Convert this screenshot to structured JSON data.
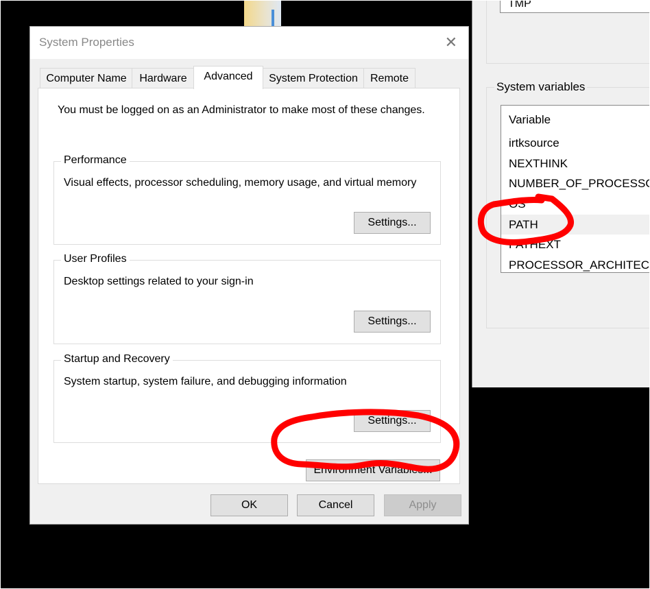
{
  "dialog": {
    "title": "System Properties",
    "close_icon": "close-icon",
    "tabs": [
      {
        "label": "Computer Name"
      },
      {
        "label": "Hardware"
      },
      {
        "label": "Advanced",
        "active": true
      },
      {
        "label": "System Protection"
      },
      {
        "label": "Remote"
      }
    ],
    "admin_note": "You must be logged on as an Administrator to make most of these changes.",
    "groups": [
      {
        "title": "Performance",
        "description": "Visual effects, processor scheduling, memory usage, and virtual memory",
        "button": "Settings..."
      },
      {
        "title": "User Profiles",
        "description": "Desktop settings related to your sign-in",
        "button": "Settings..."
      },
      {
        "title": "Startup and Recovery",
        "description": "System startup, system failure, and debugging information",
        "button": "Settings..."
      }
    ],
    "env_button": "Environment Variables...",
    "ok": "OK",
    "cancel": "Cancel",
    "apply": "Apply"
  },
  "env_window": {
    "user_list_last": "TMP",
    "system_label": "System variables",
    "column_header": "Variable",
    "rows": [
      "irtksource",
      "NEXTHINK",
      "NUMBER_OF_PROCESSORS",
      "OS",
      "PATH",
      "PATHEXT",
      "PROCESSOR_ARCHITECTURE"
    ],
    "selected": "PATH"
  },
  "annotation_color": "#ff0000"
}
